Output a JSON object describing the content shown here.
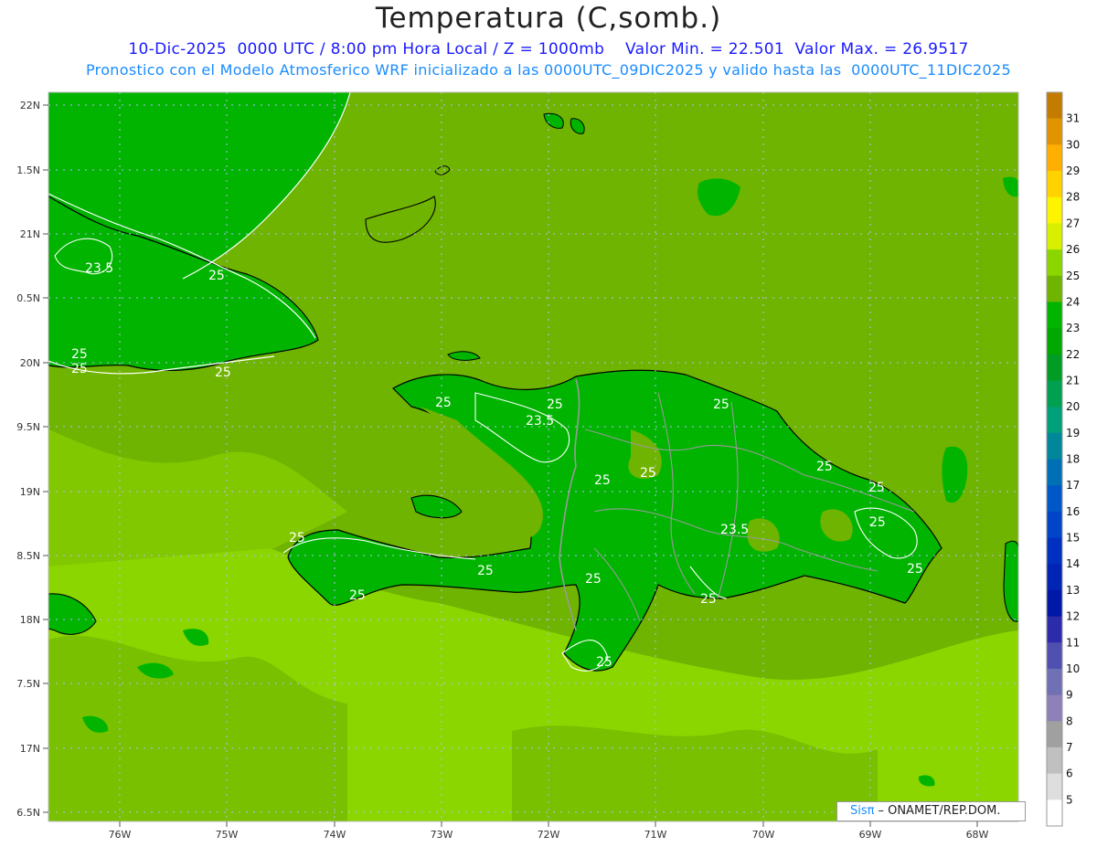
{
  "header": {
    "title": "Temperatura (C,somb.)",
    "line1": "10-Dic-2025  0000 UTC / 8:00 pm Hora Local / Z = 1000mb    Valor Min. = 22.501  Valor Max. = 26.9517",
    "line2": "Pronostico con el Modelo Atmosferico WRF inicializado a las 0000UTC_09DIC2025 y valido hasta las  0000UTC_11DIC2025"
  },
  "axes": {
    "lat_labels": [
      "22N",
      "1.5N",
      "21N",
      "0.5N",
      "20N",
      "9.5N",
      "19N",
      "8.5N",
      "18N",
      "7.5N",
      "17N",
      "6.5N"
    ],
    "lon_labels": [
      "76W",
      "75W",
      "74W",
      "73W",
      "72W",
      "71W",
      "70W",
      "69W",
      "68W"
    ]
  },
  "contour_labels": [
    "23.5",
    "25",
    "25",
    "25",
    "25",
    "25",
    "23.5",
    "25",
    "25",
    "25",
    "25",
    "25",
    "25",
    "23.5",
    "25",
    "25",
    "25",
    "25",
    "25",
    "25",
    "25",
    "25"
  ],
  "colorbar": {
    "labels": [
      "31",
      "30",
      "29",
      "28",
      "27",
      "26",
      "25",
      "24",
      "23",
      "22",
      "21",
      "20",
      "19",
      "18",
      "17",
      "16",
      "15",
      "14",
      "13",
      "12",
      "11",
      "10",
      "9",
      "8",
      "7",
      "6",
      "5"
    ],
    "colors": [
      "#c47c00",
      "#e09400",
      "#ffaf00",
      "#ffd200",
      "#fdf400",
      "#d6f000",
      "#8cd600",
      "#6fb400",
      "#00b400",
      "#00a800",
      "#009c24",
      "#00a050",
      "#00a078",
      "#00889a",
      "#0070b4",
      "#0058c8",
      "#0044c8",
      "#0030c0",
      "#0024b4",
      "#0018a8",
      "#2c2caa",
      "#5050b0",
      "#7070b4",
      "#8e80b8",
      "#a0a0a0",
      "#c0c0c0",
      "#dedede",
      "#ffffff"
    ]
  },
  "legend_colors": {
    "dark_green": "#00b400",
    "mid_green": "#6fb400",
    "light_green": "#8cd600",
    "coast": "#000000",
    "border": "#888888",
    "contour": "#ffffff"
  },
  "credit": {
    "sis": "Sisπ",
    "rest": "– ONAMET/REP.DOM."
  }
}
